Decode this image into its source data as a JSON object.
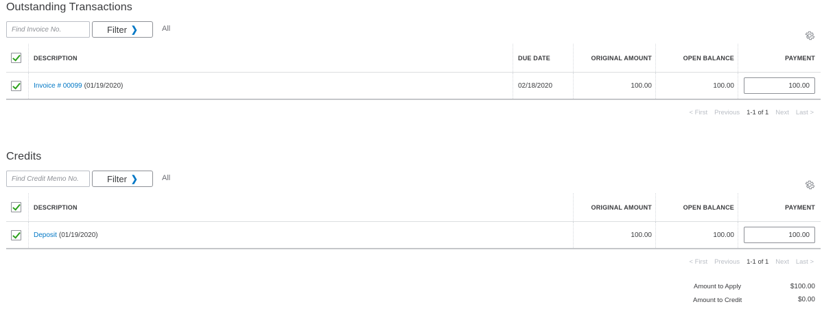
{
  "outstanding": {
    "title": "Outstanding Transactions",
    "search_placeholder": "Find Invoice No.",
    "filter_label": "Filter",
    "filter_state": "All",
    "columns": {
      "description": "DESCRIPTION",
      "due_date": "DUE DATE",
      "original_amount": "ORIGINAL AMOUNT",
      "open_balance": "OPEN BALANCE",
      "payment": "PAYMENT"
    },
    "rows": [
      {
        "link": "Invoice # 00099",
        "date": "(01/19/2020)",
        "due_date": "02/18/2020",
        "original_amount": "100.00",
        "open_balance": "100.00",
        "payment": "100.00"
      }
    ],
    "pager": {
      "first": "< First",
      "previous": "Previous",
      "range": "1-1 of 1",
      "next": "Next",
      "last": "Last >"
    }
  },
  "credits": {
    "title": "Credits",
    "search_placeholder": "Find Credit Memo No.",
    "filter_label": "Filter",
    "filter_state": "All",
    "columns": {
      "description": "DESCRIPTION",
      "original_amount": "ORIGINAL AMOUNT",
      "open_balance": "OPEN BALANCE",
      "payment": "PAYMENT"
    },
    "rows": [
      {
        "link": "Deposit",
        "date": "(01/19/2020)",
        "original_amount": "100.00",
        "open_balance": "100.00",
        "payment": "100.00"
      }
    ],
    "pager": {
      "first": "< First",
      "previous": "Previous",
      "range": "1-1 of 1",
      "next": "Next",
      "last": "Last >"
    }
  },
  "summary": {
    "amount_to_apply_label": "Amount to Apply",
    "amount_to_apply_value": "$100.00",
    "amount_to_credit_label": "Amount to Credit",
    "amount_to_credit_value": "$0.00"
  },
  "colors": {
    "link": "#0077c5",
    "check": "#2ca01c"
  }
}
